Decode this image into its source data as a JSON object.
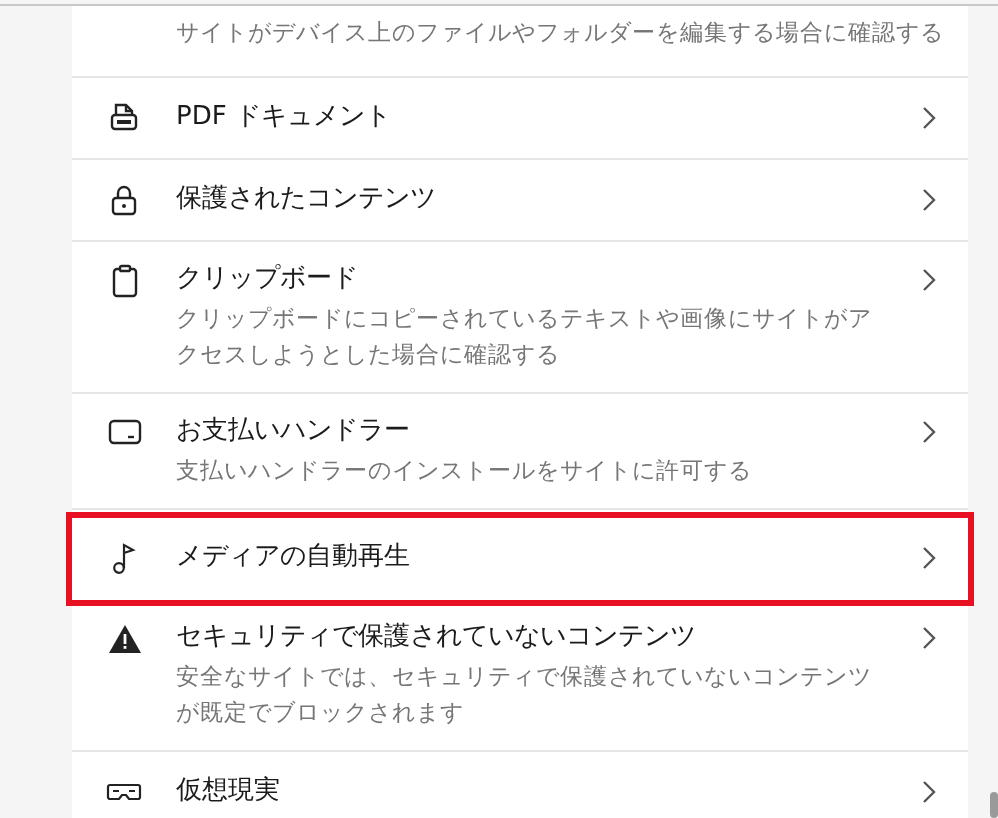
{
  "items": [
    {
      "kind": "partial",
      "description": "サイトがデバイス上のファイルやフォルダーを編集する場合に確認する",
      "highlighted": false
    },
    {
      "kind": "pdf",
      "title": "PDF ドキュメント",
      "highlighted": false
    },
    {
      "kind": "lock",
      "title": "保護されたコンテンツ",
      "highlighted": false
    },
    {
      "kind": "clipboard",
      "title": "クリップボード",
      "description": "クリップボードにコピーされているテキストや画像にサイトがアクセスしようとした場合に確認する",
      "highlighted": false
    },
    {
      "kind": "card",
      "title": "お支払いハンドラー",
      "description": "支払いハンドラーのインストールをサイトに許可する",
      "highlighted": false
    },
    {
      "kind": "note",
      "title": "メディアの自動再生",
      "highlighted": true
    },
    {
      "kind": "warning",
      "title": "セキュリティで保護されていないコンテンツ",
      "description": "安全なサイトでは、セキュリティで保護されていないコンテンツが既定でブロックされます",
      "highlighted": false
    },
    {
      "kind": "headset",
      "title": "仮想現実",
      "highlighted": false
    }
  ]
}
